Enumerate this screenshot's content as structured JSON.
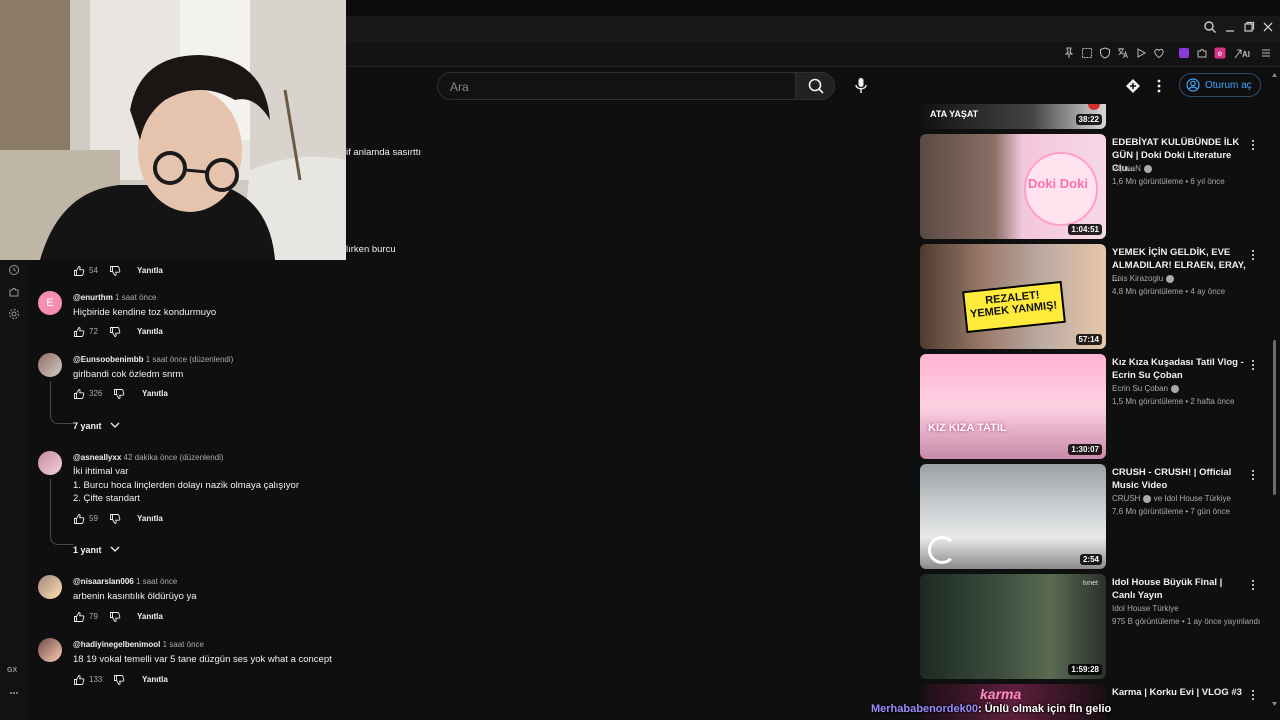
{
  "colors": {
    "bg": "#0f0f0f",
    "accent": "#3ea6ff",
    "text": "#f1f1f1",
    "muted": "#aaaaaa"
  },
  "header": {
    "search_placeholder": "Ara",
    "signin_label": "Oturum aç",
    "ext_ai_label": "AI"
  },
  "sidebar": {
    "gx_label": "GX"
  },
  "partial_texts": {
    "line1": "if anlamda sasırttı",
    "line2": "lırken burcu"
  },
  "comments": [
    {
      "likes": "54",
      "reply": "Yanıtla"
    },
    {
      "author": "@enurthm",
      "time": "1 saat önce",
      "lines": [
        "Hiçbiride kendine toz kondurmuyo"
      ],
      "likes": "72",
      "reply": "Yanıtla"
    },
    {
      "author": "@Eunsoobenimbb",
      "time": "1 saat önce (düzenlendi)",
      "lines": [
        "girlbandi cok özledm snrm"
      ],
      "likes": "326",
      "reply": "Yanıtla",
      "replies": "7 yanıt"
    },
    {
      "author": "@asneallyxx",
      "time": "42 dakika önce (düzenlendi)",
      "lines": [
        "İki ihtimal var",
        "1. Burcu hoca linçlerden dolayı nazik olmaya çalışıyor",
        "2. Çifte standart"
      ],
      "likes": "59",
      "reply": "Yanıtla",
      "replies": "1 yanıt"
    },
    {
      "author": "@nisaarslan006",
      "time": "1 saat önce",
      "lines": [
        "arbenin kasıntılık öldürüyo ya"
      ],
      "likes": "79",
      "reply": "Yanıtla"
    },
    {
      "author": "@hadiyinegelbenimool",
      "time": "1 saat önce",
      "lines": [
        "18 19 vokal temelli var 5 tane düzgün ses yok what a concept"
      ],
      "likes": "133",
      "reply": "Yanıtla"
    }
  ],
  "videos": [
    {
      "title": "",
      "channel": "",
      "meta": "",
      "duration": "38:22",
      "thumb_text": "ATA YAŞAT"
    },
    {
      "title": "EDEBİYAT KULÜBÜNDE İLK GÜN | Doki Doki Literature Clu...",
      "channel": "PqueeN",
      "meta": "1,6 Mn görüntüleme • 6 yıl önce",
      "duration": "1:04:51",
      "thumb_text": "Doki Doki"
    },
    {
      "title": "YEMEK İÇİN GELDİK, EVE ALMADILAR! ELRAEN, ERAY, ...",
      "channel": "Enis Kirazoglu",
      "meta": "4,8 Mn görüntüleme • 4 ay önce",
      "duration": "57:14",
      "thumb_text": "REZALET! YEMEK YANMIŞ!"
    },
    {
      "title": "Kız Kıza Kuşadası Tatil Vlog - Ecrin Su Çoban",
      "channel": "Ecrin Su Çoban",
      "meta": "1,5 Mn görüntüleme • 2 hafta önce",
      "duration": "1:30:07",
      "thumb_text": "KIZ KIZA TATİL"
    },
    {
      "title": "CRUSH - CRUSH! | Official Music Video",
      "channel": "CRUSH",
      "channel_extra": "ve Idol House Türkiye",
      "meta": "7,6 Mn görüntüleme • 7 gün önce",
      "duration": "2:54"
    },
    {
      "title": "Idol House Büyük Final | Canlı Yayın",
      "channel": "Idol House Türkiye",
      "meta": "975 B görüntüleme • 1 ay önce yayınlandı",
      "duration": "1:59:28",
      "thumb_text": "tvnet"
    },
    {
      "title": "Karma | Korku Evi | VLOG #3",
      "channel": "",
      "meta": "",
      "duration": "",
      "thumb_text": "karma"
    }
  ],
  "overlay": {
    "user": "Merhababenordek00",
    "message": ": Ünlü olmak için fln gelio"
  }
}
